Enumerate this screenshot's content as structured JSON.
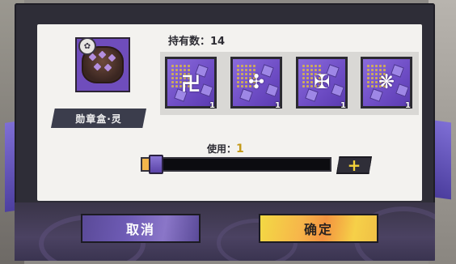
{
  "item": {
    "name": "勋章盒·灵",
    "held_label": "持有数：14"
  },
  "medals": [
    {
      "glyph": "卍",
      "count": "1"
    },
    {
      "glyph": "✣",
      "count": "1"
    },
    {
      "glyph": "✠",
      "count": "1"
    },
    {
      "glyph": "❋",
      "count": "1"
    }
  ],
  "usage": {
    "label": "使用：",
    "count": "1",
    "fill_fraction": 0.07
  },
  "buttons": {
    "plus": "+",
    "cancel": "取消",
    "confirm": "确定"
  },
  "colors": {
    "accent_purple": "#6f4dbc",
    "confirm_yellow": "#f3d944",
    "count_gold": "#c49a18"
  }
}
